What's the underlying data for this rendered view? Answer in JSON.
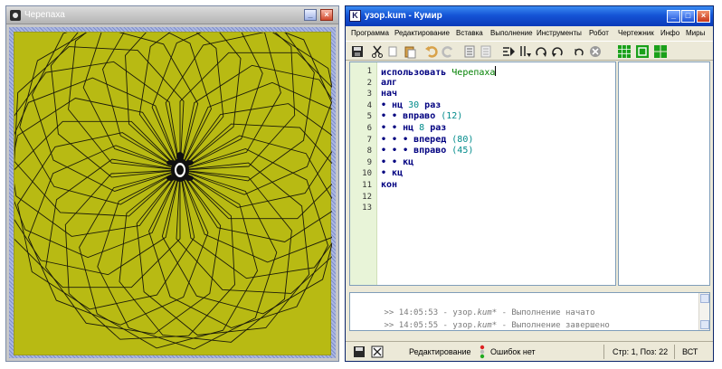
{
  "turtle_window": {
    "title": "Черепаха",
    "canvas_color": "#b8ba13",
    "drawing": {
      "outer_repeats": 30,
      "inner_repeats": 8,
      "forward": 80,
      "turn_inner": 45,
      "turn_outer": 12
    }
  },
  "kumir_window": {
    "title": "узор.kum - Кумир",
    "app_icon_letter": "K",
    "menu": [
      "Программа",
      "Редактирование",
      "Вставка",
      "Выполнение",
      "Инструменты",
      "Робот",
      "Чертежник",
      "Инфо",
      "Миры"
    ],
    "toolbar_icons": [
      "save-icon",
      "cut-icon",
      "copy-icon",
      "paste-icon",
      "undo-icon",
      "redo-icon",
      "indent-icon",
      "outdent-icon",
      "run-icon",
      "step-icon",
      "step-into-icon",
      "step-out-icon",
      "step-over-icon",
      "stop-icon",
      "grid-icon",
      "robot-field-icon",
      "draw-field-icon"
    ],
    "editor": {
      "line_numbers": [
        "1",
        "2",
        "3",
        "4",
        "5",
        "6",
        "7",
        "8",
        "9",
        "10",
        "11",
        "12",
        "13"
      ],
      "lines": [
        {
          "parts": [
            [
              "kw",
              "использовать "
            ],
            [
              "str",
              "Черепаха"
            ]
          ]
        },
        {
          "parts": [
            [
              "kw",
              "алг"
            ]
          ]
        },
        {
          "parts": [
            [
              "kw",
              "нач"
            ]
          ]
        },
        {
          "parts": [
            [
              "dot",
              "• "
            ],
            [
              "kw",
              "нц "
            ],
            [
              "num",
              "30"
            ],
            [
              "kw",
              " раз"
            ]
          ]
        },
        {
          "parts": [
            [
              "dot",
              "• • "
            ],
            [
              "kw",
              "вправо "
            ],
            [
              "num",
              "(12)"
            ]
          ]
        },
        {
          "parts": [
            [
              "dot",
              "• • "
            ],
            [
              "kw",
              "нц "
            ],
            [
              "num",
              "8"
            ],
            [
              "kw",
              " раз"
            ]
          ]
        },
        {
          "parts": [
            [
              "dot",
              "• • • "
            ],
            [
              "kw",
              "вперед "
            ],
            [
              "num",
              "(80)"
            ]
          ]
        },
        {
          "parts": [
            [
              "dot",
              "• • • "
            ],
            [
              "kw",
              "вправо "
            ],
            [
              "num",
              "(45)"
            ]
          ]
        },
        {
          "parts": [
            [
              "dot",
              "• • "
            ],
            [
              "kw",
              "кц"
            ]
          ]
        },
        {
          "parts": [
            [
              "dot",
              "• "
            ],
            [
              "kw",
              "кц"
            ]
          ]
        },
        {
          "parts": [
            [
              "kw",
              "кон"
            ]
          ]
        },
        {
          "parts": []
        },
        {
          "parts": []
        }
      ]
    },
    "console": {
      "lines": [
        {
          "prefix": ">> 14:05:53 - узор.",
          "file": "kum",
          "suffix": "* - Выполнение начато"
        },
        {
          "prefix": ">> 14:05:55 - узор.",
          "file": "kum",
          "suffix": "* - Выполнение завершено"
        }
      ]
    },
    "status": {
      "mode": "Редактирование",
      "errors": "Ошибок нет",
      "position": "Стр: 1, Поз: 22",
      "insert_mode": "ВСТ"
    }
  }
}
